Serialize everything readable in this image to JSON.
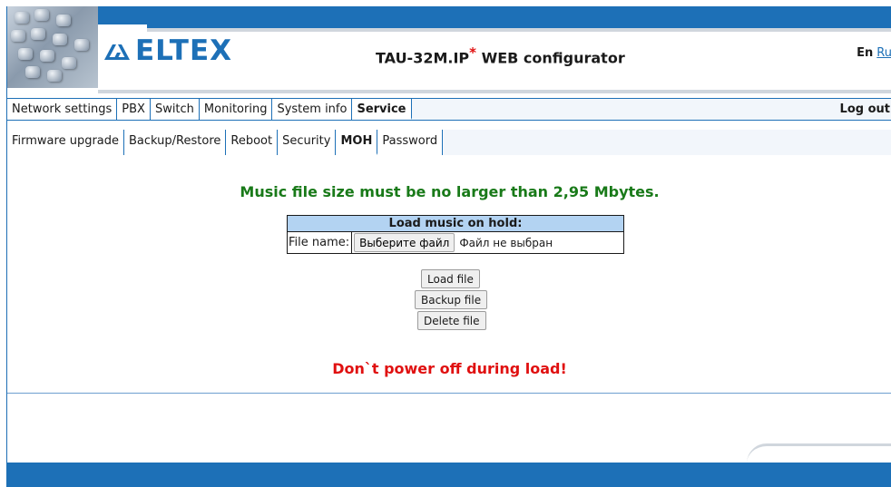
{
  "header": {
    "logo_text": "ELTEX",
    "app_title": "TAU-32M.IP",
    "app_title_mark": "*",
    "app_title_suffix": " WEB configurator",
    "lang_current": "En",
    "lang_other": "Ru"
  },
  "menu": {
    "items": [
      {
        "label": "Network settings"
      },
      {
        "label": "PBX"
      },
      {
        "label": "Switch"
      },
      {
        "label": "Monitoring"
      },
      {
        "label": "System info"
      },
      {
        "label": "Service",
        "active": true
      }
    ],
    "logout_label": "Log out"
  },
  "submenu": {
    "items": [
      {
        "label": "Firmware upgrade"
      },
      {
        "label": "Backup/Restore"
      },
      {
        "label": "Reboot"
      },
      {
        "label": "Security"
      },
      {
        "label": "MOH",
        "active": true
      },
      {
        "label": "Password"
      }
    ]
  },
  "content": {
    "size_note": "Music file size must be no larger than 2,95 Mbytes.",
    "load_table": {
      "title": "Load music on hold:",
      "file_label": "File name:",
      "choose_button": "Выберите файл",
      "file_status": "Файл не выбран"
    },
    "buttons": {
      "load": "Load file",
      "backup": "Backup file",
      "delete": "Delete file"
    },
    "warning": "Don`t power off during load!"
  },
  "colors": {
    "brand_blue": "#1d70b7",
    "note_green": "#197a19",
    "warning_red": "#e01010",
    "table_header": "#b3d3f2"
  },
  "icons": {
    "logo": "eltex-logo-icon"
  }
}
